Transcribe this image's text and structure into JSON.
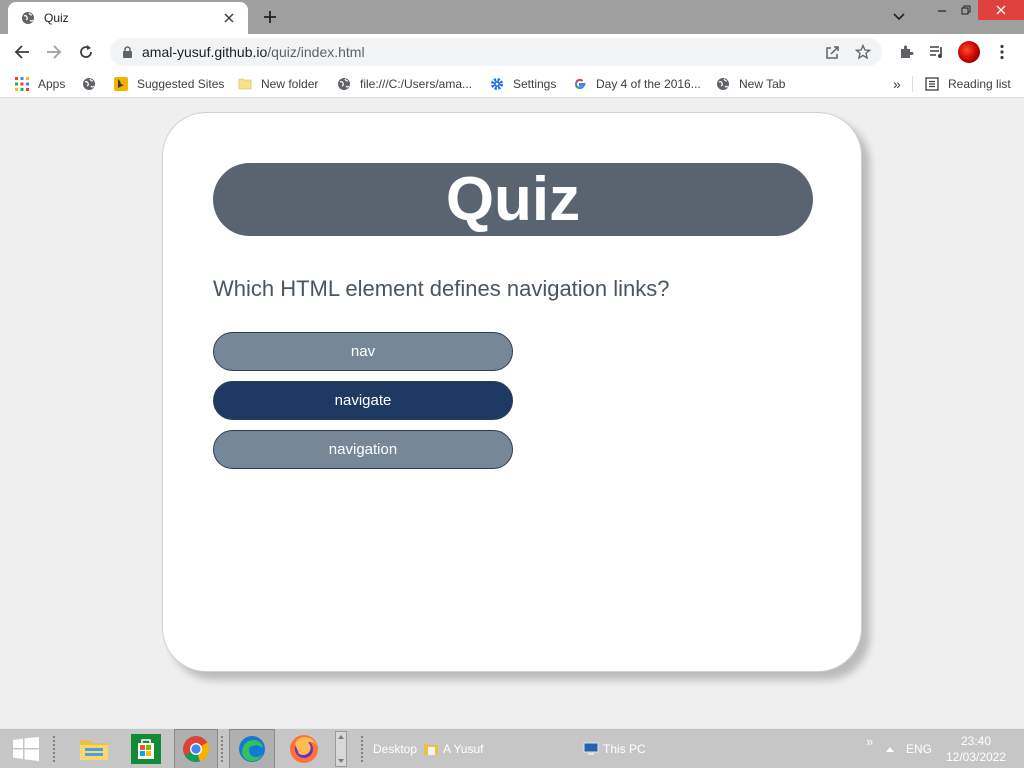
{
  "browser": {
    "tab": {
      "title": "Quiz"
    },
    "address_bar": {
      "host": "amal-yusuf.github.io",
      "path": "/quiz/index.html"
    },
    "bookmarks": [
      {
        "label": "Apps",
        "icon": "apps-grid-icon"
      },
      {
        "label": "",
        "icon": "globe-icon"
      },
      {
        "label": "Suggested Sites",
        "icon": "bing-icon"
      },
      {
        "label": "New folder",
        "icon": "folder-icon"
      },
      {
        "label": "file:///C:/Users/ama...",
        "icon": "globe-icon"
      },
      {
        "label": "Settings",
        "icon": "gear-icon"
      },
      {
        "label": "Day 4 of the 2016...",
        "icon": "google-icon"
      },
      {
        "label": "New Tab",
        "icon": "globe-icon"
      }
    ],
    "bookmarks_overflow": "»",
    "reading_list": "Reading list"
  },
  "quiz": {
    "title": "Quiz",
    "question": "Which HTML element defines navigation links?",
    "answers": [
      "nav",
      "navigate",
      "navigation"
    ],
    "selected_index": 1
  },
  "taskbar": {
    "desktop_label": "Desktop",
    "user_label": "A Yusuf",
    "this_pc_label": "This PC",
    "overflow": "»",
    "lang": "ENG",
    "time": "23:40",
    "date": "12/03/2022"
  },
  "colors": {
    "title_bg": "#5a6470",
    "answer_bg": "#77879a",
    "answer_selected_bg": "#1e3a63",
    "question_text": "#4a5562"
  }
}
